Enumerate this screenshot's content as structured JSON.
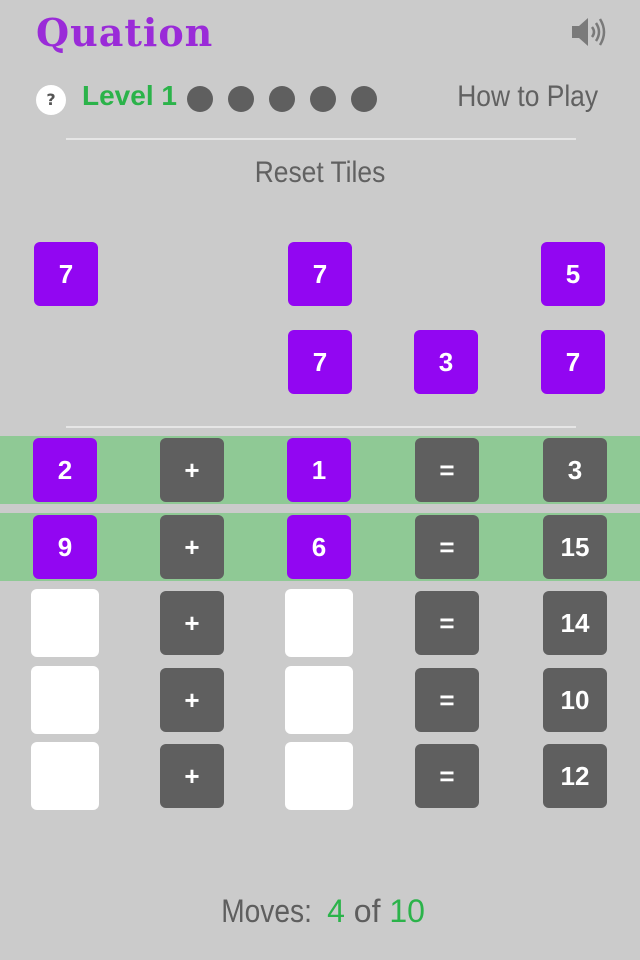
{
  "header": {
    "logo": "Quation",
    "sound_icon": "speaker-icon"
  },
  "status": {
    "help_label": "?",
    "level_label": "Level 1",
    "progress_dots": 5,
    "how_to_play": "How to Play"
  },
  "reset_label": "Reset Tiles",
  "pool": {
    "row1": [
      "7",
      "7",
      "5"
    ],
    "row2": [
      "7",
      "3",
      "7"
    ]
  },
  "equations": [
    {
      "a": "2",
      "op": "+",
      "b": "1",
      "eq": "=",
      "result": "3",
      "solved": true
    },
    {
      "a": "9",
      "op": "+",
      "b": "6",
      "eq": "=",
      "result": "15",
      "solved": true
    },
    {
      "a": "",
      "op": "+",
      "b": "",
      "eq": "=",
      "result": "14",
      "solved": false
    },
    {
      "a": "",
      "op": "+",
      "b": "",
      "eq": "=",
      "result": "10",
      "solved": false
    },
    {
      "a": "",
      "op": "+",
      "b": "",
      "eq": "=",
      "result": "12",
      "solved": false
    }
  ],
  "moves": {
    "label": "Moves:",
    "current": "4",
    "of": "of",
    "total": "10"
  },
  "colors": {
    "tile_purple": "#9206f2",
    "tile_gray": "#5f5f5f",
    "accent_green": "#2bb34a",
    "solved_band": "#8fc995",
    "logo_purple": "#9a2bd8"
  }
}
